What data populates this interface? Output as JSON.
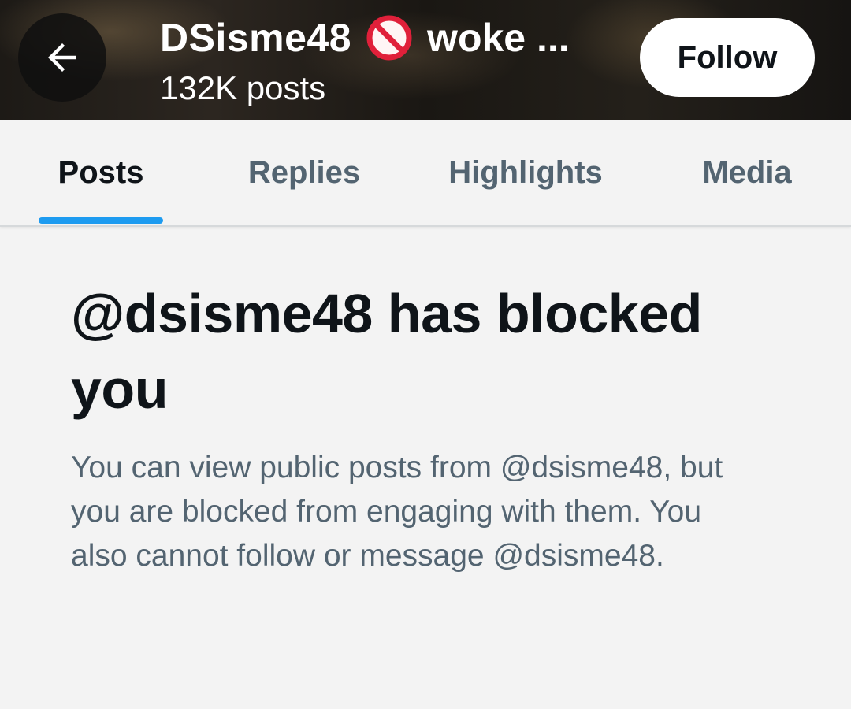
{
  "header": {
    "display_name": "DSisme48",
    "name_icon": "prohibited-icon",
    "name_tail": "woke ...",
    "post_count": "132K posts",
    "follow_label": "Follow",
    "back_icon": "arrow-left-icon"
  },
  "tabs": [
    {
      "label": "Posts",
      "active": true
    },
    {
      "label": "Replies",
      "active": false
    },
    {
      "label": "Highlights",
      "active": false
    },
    {
      "label": "Media",
      "active": false
    }
  ],
  "blocked": {
    "title": "@dsisme48 has blocked you",
    "description": "You can view public posts from @dsisme48, but you are blocked from engaging with them. You also cannot follow or message @dsisme48."
  },
  "colors": {
    "accent": "#1d9bf0",
    "primary_text": "#0f1419",
    "secondary_text": "#536471",
    "prohibited_red": "#e0203a"
  }
}
